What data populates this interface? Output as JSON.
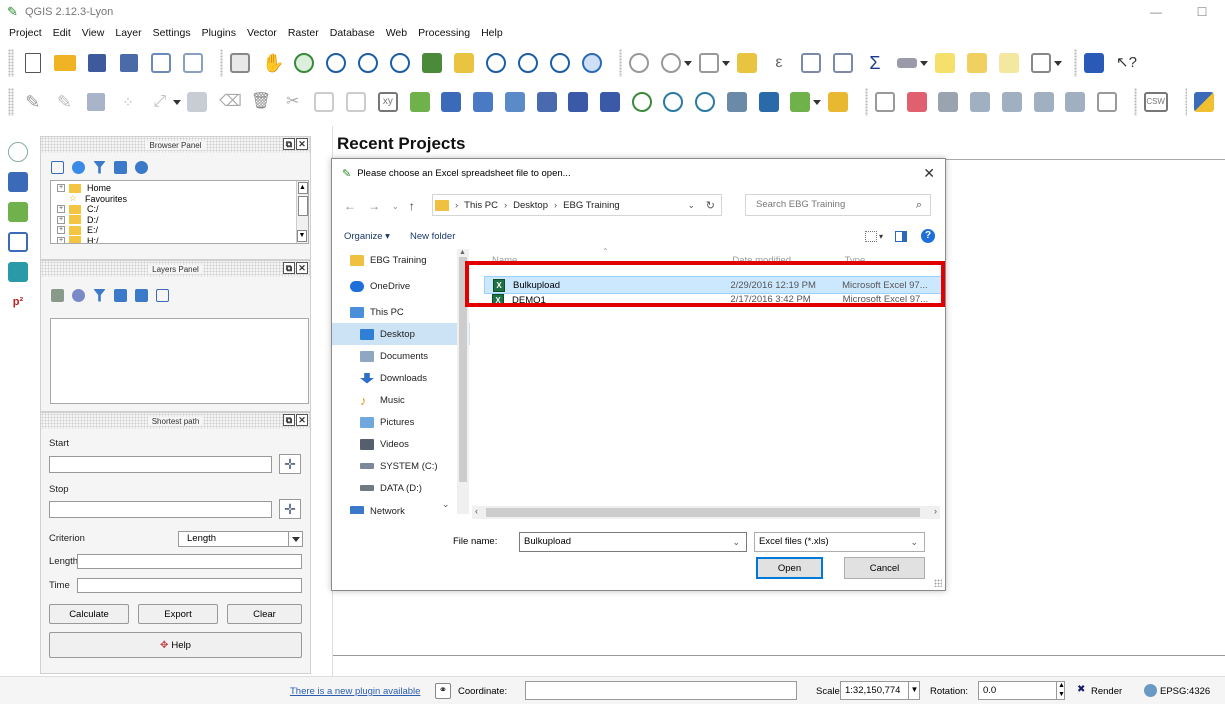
{
  "window": {
    "title": "QGIS 2.12.3-Lyon",
    "minimize": "—",
    "restore": "☐"
  },
  "menu": [
    "Project",
    "Edit",
    "View",
    "Layer",
    "Settings",
    "Plugins",
    "Vector",
    "Raster",
    "Database",
    "Web",
    "Processing",
    "Help"
  ],
  "toolbar2": {
    "csw_label": "CSW",
    "xy_label": "xy"
  },
  "browser_panel": {
    "title": "Browser Panel",
    "tree": [
      {
        "label": "Home",
        "expander": "+"
      },
      {
        "label": "Favourites",
        "expander": ""
      },
      {
        "label": "C:/",
        "expander": "+"
      },
      {
        "label": "D:/",
        "expander": "+"
      },
      {
        "label": "E:/",
        "expander": "+"
      },
      {
        "label": "H:/",
        "expander": "+"
      }
    ]
  },
  "layers_panel": {
    "title": "Layers Panel"
  },
  "shortest_path": {
    "title": "Shortest path",
    "start_label": "Start",
    "stop_label": "Stop",
    "criterion_label": "Criterion",
    "criterion_value": "Length",
    "length_label": "Length",
    "time_label": "Time",
    "calculate": "Calculate",
    "export": "Export",
    "clear": "Clear",
    "help": "Help"
  },
  "main": {
    "recent_projects": "Recent Projects"
  },
  "dialog": {
    "title": "Please choose an Excel spreadsheet file to open...",
    "close": "✕",
    "breadcrumb": [
      "This PC",
      "Desktop",
      "EBG Training"
    ],
    "search_placeholder": "Search EBG Training",
    "organize": "Organize ▾",
    "new_folder": "New folder",
    "nav_items": [
      {
        "label": "EBG Training",
        "color": "#f0c040"
      },
      {
        "label": "OneDrive",
        "color": "#1e6fd9"
      },
      {
        "label": "This PC",
        "color": "#4a90d9"
      },
      {
        "label": "Desktop",
        "color": "#2f7fd6",
        "selected": true
      },
      {
        "label": "Documents",
        "color": "#8fa7c0"
      },
      {
        "label": "Downloads",
        "color": "#2d6fc9"
      },
      {
        "label": "Music",
        "color": "#e09a1a"
      },
      {
        "label": "Pictures",
        "color": "#6fa8dc"
      },
      {
        "label": "Videos",
        "color": "#555f6e"
      },
      {
        "label": "SYSTEM (C:)",
        "color": "#7a8a99"
      },
      {
        "label": "DATA (D:)",
        "color": "#6f7a85"
      },
      {
        "label": "Network",
        "color": "#3a78c9"
      }
    ],
    "columns": {
      "name": "Name",
      "date": "Date modified",
      "type": "Type"
    },
    "files": [
      {
        "name": "Bulkupload",
        "date": "2/29/2016 12:19 PM",
        "type": "Microsoft Excel 97...",
        "selected": true
      },
      {
        "name": "DEMO1",
        "date": "2/17/2016 3:42 PM",
        "type": "Microsoft Excel 97...",
        "selected": false
      }
    ],
    "file_name_label": "File name:",
    "file_name_value": "Bulkupload",
    "filter_value": "Excel files (*.xls)",
    "open": "Open",
    "cancel": "Cancel"
  },
  "statusbar": {
    "plugin_link": "There is a new plugin available",
    "coordinate_label": "Coordinate:",
    "coordinate_value": "",
    "scale_label": "Scale",
    "scale_value": "1:32,150,774",
    "rotation_label": "Rotation:",
    "rotation_value": "0.0",
    "render_label": "Render",
    "epsg_label": "EPSG:4326"
  },
  "colors": {
    "highlight_box": "#e00000",
    "selection": "#cce8ff",
    "accent": "#0078d7"
  }
}
